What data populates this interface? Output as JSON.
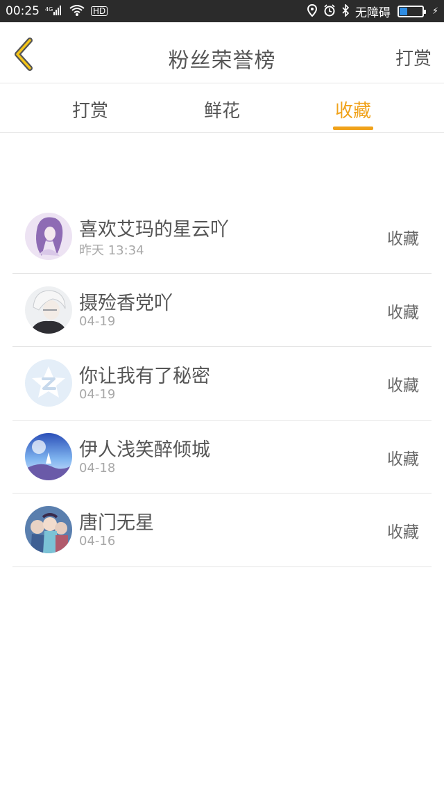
{
  "status_bar": {
    "time": "00:25",
    "network": "4G",
    "wifi_icon": "wifi-icon",
    "hd": "HD",
    "carrier": "无障碍",
    "battery_level": 0.35
  },
  "header": {
    "title": "粉丝荣誉榜",
    "right_action": "打赏",
    "back_icon": "chevron-left-icon",
    "accent": "#f0a21a"
  },
  "tabs": [
    {
      "label": "打赏",
      "active": false
    },
    {
      "label": "鲜花",
      "active": false
    },
    {
      "label": "收藏",
      "active": true
    }
  ],
  "fans": [
    {
      "name": "喜欢艾玛的星云吖",
      "time": "昨天 13:34",
      "action": "收藏",
      "avatar": "purple-anime-girl"
    },
    {
      "name": "摄殓香党吖",
      "time": "04-19",
      "action": "收藏",
      "avatar": "white-haired-boy"
    },
    {
      "name": "你让我有了秘密",
      "time": "04-19",
      "action": "收藏",
      "avatar": "default-qq-star"
    },
    {
      "name": "伊人浅笑醉倾城",
      "time": "04-18",
      "action": "收藏",
      "avatar": "blue-sky-scene"
    },
    {
      "name": "唐门无星",
      "time": "04-16",
      "action": "收藏",
      "avatar": "group-anime-characters"
    }
  ]
}
